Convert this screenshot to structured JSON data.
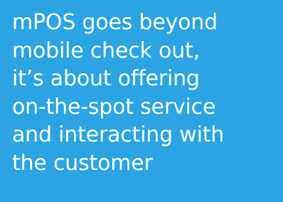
{
  "colors": {
    "background": "#2aa4e3",
    "text": "#ffffff"
  },
  "quote": {
    "lines": [
      "mPOS goes beyond",
      "mobile check out,",
      "it’s about offering",
      "on-the-spot service",
      "and interacting with",
      "the customer"
    ]
  }
}
